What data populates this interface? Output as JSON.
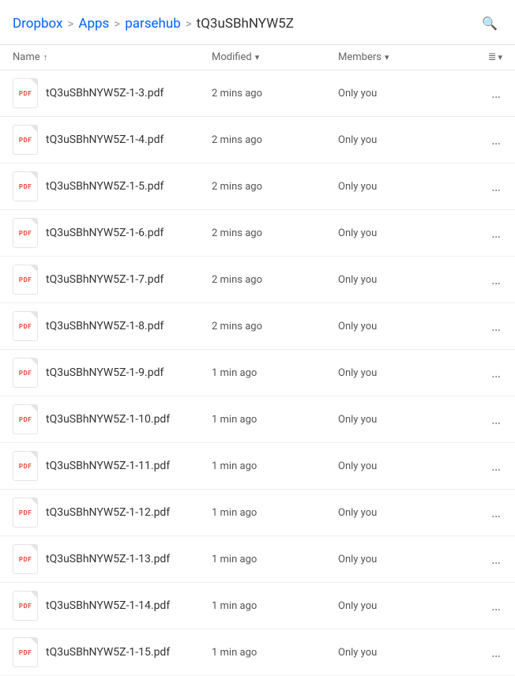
{
  "breadcrumb": {
    "items": [
      {
        "label": "Dropbox",
        "id": "dropbox"
      },
      {
        "label": "Apps",
        "id": "apps"
      },
      {
        "label": "parsehub",
        "id": "parsehub"
      },
      {
        "label": "tQ3uSBhNYW5Z",
        "id": "folder"
      }
    ],
    "separator": ">"
  },
  "search_button_title": "Search",
  "columns": {
    "name": {
      "label": "Name",
      "sort": "↑"
    },
    "modified": {
      "label": "Modified",
      "sort": "▾"
    },
    "members": {
      "label": "Members",
      "sort": "▾"
    },
    "list_icon": "☰"
  },
  "files": [
    {
      "name": "tQ3uSBhNYW5Z-1-3.pdf",
      "modified": "2 mins ago",
      "members": "Only you"
    },
    {
      "name": "tQ3uSBhNYW5Z-1-4.pdf",
      "modified": "2 mins ago",
      "members": "Only you"
    },
    {
      "name": "tQ3uSBhNYW5Z-1-5.pdf",
      "modified": "2 mins ago",
      "members": "Only you"
    },
    {
      "name": "tQ3uSBhNYW5Z-1-6.pdf",
      "modified": "2 mins ago",
      "members": "Only you"
    },
    {
      "name": "tQ3uSBhNYW5Z-1-7.pdf",
      "modified": "2 mins ago",
      "members": "Only you"
    },
    {
      "name": "tQ3uSBhNYW5Z-1-8.pdf",
      "modified": "2 mins ago",
      "members": "Only you"
    },
    {
      "name": "tQ3uSBhNYW5Z-1-9.pdf",
      "modified": "1 min ago",
      "members": "Only you"
    },
    {
      "name": "tQ3uSBhNYW5Z-1-10.pdf",
      "modified": "1 min ago",
      "members": "Only you"
    },
    {
      "name": "tQ3uSBhNYW5Z-1-11.pdf",
      "modified": "1 min ago",
      "members": "Only you"
    },
    {
      "name": "tQ3uSBhNYW5Z-1-12.pdf",
      "modified": "1 min ago",
      "members": "Only you"
    },
    {
      "name": "tQ3uSBhNYW5Z-1-13.pdf",
      "modified": "1 min ago",
      "members": "Only you"
    },
    {
      "name": "tQ3uSBhNYW5Z-1-14.pdf",
      "modified": "1 min ago",
      "members": "Only you"
    },
    {
      "name": "tQ3uSBhNYW5Z-1-15.pdf",
      "modified": "1 min ago",
      "members": "Only you"
    }
  ]
}
